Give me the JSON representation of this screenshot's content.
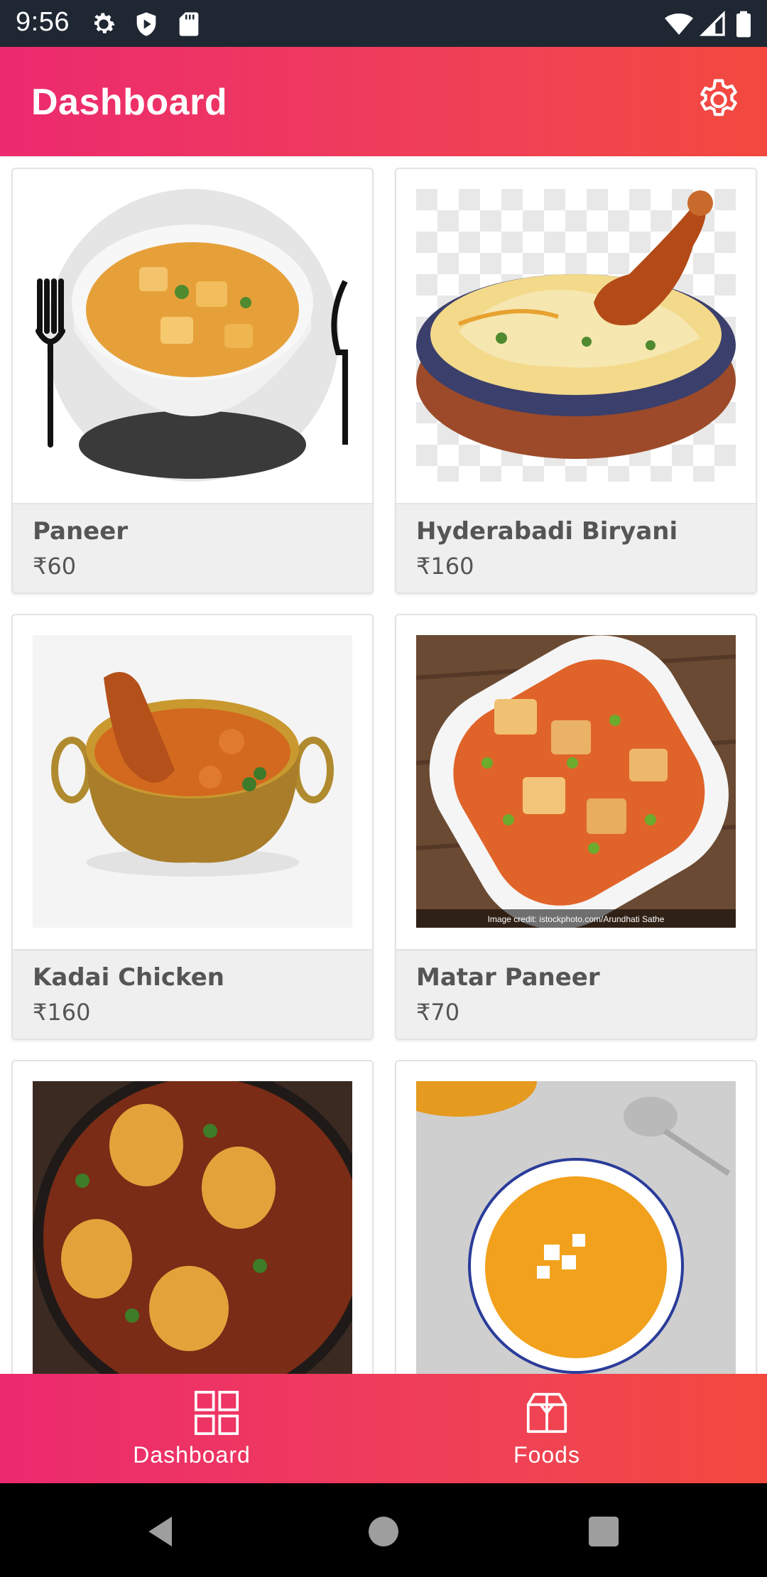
{
  "status_bar": {
    "time": "9:56",
    "left_icons": [
      "gear-icon",
      "shield-play-icon",
      "sd-card-icon"
    ],
    "right_icons": [
      "wifi-icon",
      "signal-icon",
      "battery-icon"
    ]
  },
  "app_bar": {
    "title": "Dashboard",
    "action_icon": "settings-gear-icon",
    "gradient": [
      "#ec2a6f",
      "#f2493e"
    ]
  },
  "foods": [
    {
      "name": "Paneer",
      "price": "₹60"
    },
    {
      "name": "Hyderabadi Biryani",
      "price": "₹160"
    },
    {
      "name": "Kadai Chicken",
      "price": "₹160"
    },
    {
      "name": "Matar Paneer",
      "price": "₹70",
      "image_caption": "Image credit: istockphoto.com/Arundhati Sathe"
    },
    {
      "name": "",
      "price": ""
    },
    {
      "name": "",
      "price": ""
    }
  ],
  "bottom_nav": {
    "items": [
      {
        "label": "Dashboard",
        "icon": "dashboard-grid-icon"
      },
      {
        "label": "Foods",
        "icon": "box-icon"
      }
    ]
  },
  "system_nav": [
    "back-icon",
    "home-icon",
    "recents-icon"
  ]
}
